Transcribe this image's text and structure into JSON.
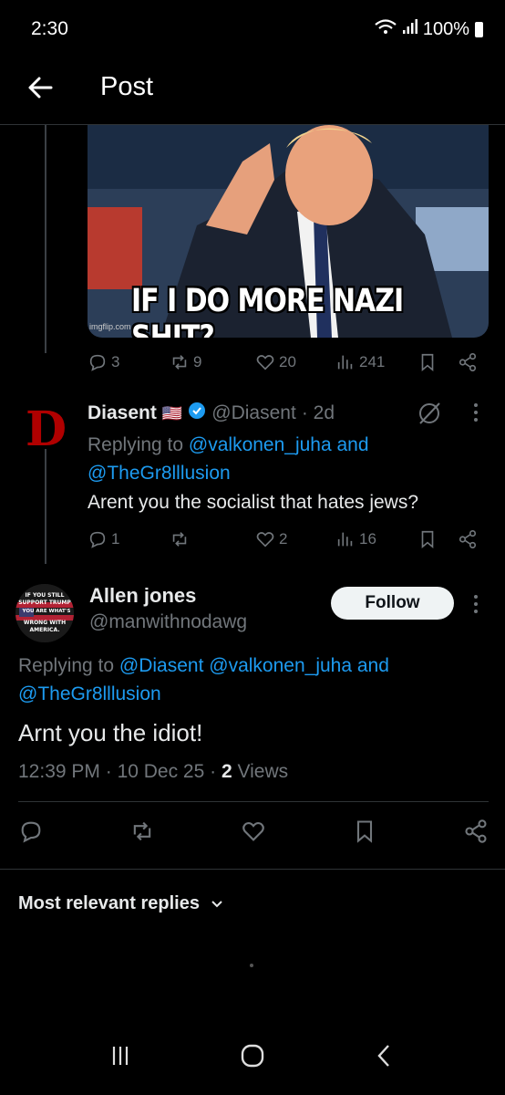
{
  "status": {
    "time": "2:30",
    "battery": "100%"
  },
  "header": {
    "title": "Post"
  },
  "meme": {
    "caption": "IF I DO MORE NAZI SHIT?",
    "watermark": "imgflip.com"
  },
  "post_stats": {
    "replies": "3",
    "reposts": "9",
    "likes": "20",
    "views": "241"
  },
  "reply1": {
    "name": "Diasent",
    "flag": "🇺🇸",
    "handle": "@Diasent",
    "time": "· 2d",
    "replying_prefix": "Replying to",
    "replying_to": "@valkonen_juha and @TheGr8lllusion",
    "text": "Arent you the socialist that hates jews?",
    "stats": {
      "replies": "1",
      "reposts": "",
      "likes": "2",
      "views": "16"
    },
    "avatar_letter": "D"
  },
  "main": {
    "name": "Allen jones",
    "handle": "@manwithnodawg",
    "follow_label": "Follow",
    "avatar_text": "IF YOU STILL SUPPORT TRUMP YOU ARE WHAT'S WRONG WITH AMERICA.",
    "replying_prefix": "Replying to",
    "replying_to": "@Diasent @valkonen_juha and @TheGr8lllusion",
    "text": "Arnt you the idiot!",
    "time": "12:39 PM",
    "date": "10 Dec 25",
    "views_count": "2",
    "views_label": "Views"
  },
  "replies_filter": {
    "label": "Most relevant replies"
  },
  "colors": {
    "accent": "#1d9bf0",
    "muted": "#71767b",
    "background": "#000000"
  }
}
